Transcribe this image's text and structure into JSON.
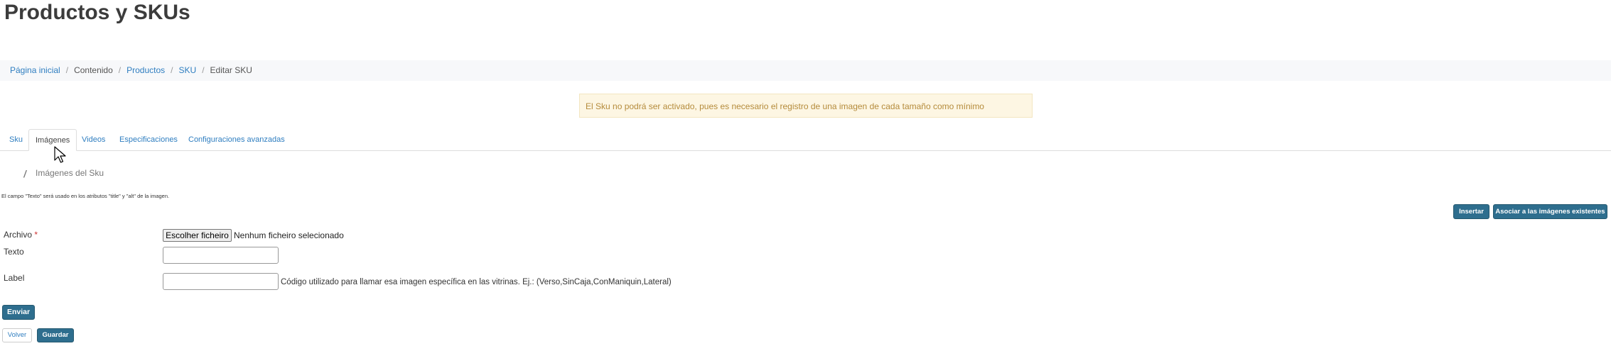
{
  "page": {
    "title": "Productos y SKUs"
  },
  "breadcrumb": [
    {
      "label": "Página inicial",
      "link": true
    },
    {
      "label": "Contenido",
      "link": false
    },
    {
      "label": "Productos",
      "link": true
    },
    {
      "label": "SKU",
      "link": true
    },
    {
      "label": "Editar SKU",
      "link": false
    }
  ],
  "alert": {
    "text": "El Sku no podrá ser activado, pues es necesario el registro de una imagen de cada tamaño como mínimo"
  },
  "tabs": [
    {
      "label": "Sku",
      "active": false
    },
    {
      "label": "Imágenes",
      "active": true
    },
    {
      "label": "Videos",
      "active": false
    },
    {
      "label": "Especificaciones",
      "active": false
    },
    {
      "label": "Configuraciones avanzadas",
      "active": false
    }
  ],
  "section": {
    "title": "Imágenes del Sku",
    "icon": "pencil-icon"
  },
  "note": "El campo \"Texto\" será usado en los atributos \"title\" y \"alt\" de la imagen.",
  "actions": {
    "insert": "Insertar",
    "associate": "Asociar a las imágenes existentes"
  },
  "form": {
    "archivo_label": "Archivo",
    "required_mark": "*",
    "file_button": "Escolher ficheiro",
    "file_status": "Nenhum ficheiro selecionado",
    "texto_label": "Texto",
    "texto_value": "",
    "label_label": "Label",
    "label_value": "",
    "label_hint": "Código utilizado para llamar esa imagen específica en las vitrinas. Ej.: (Verso,SinCaja,ConManiquin,Lateral)",
    "submit": "Enviar"
  },
  "footer": {
    "back": "Volver",
    "save": "Guardar"
  },
  "colors": {
    "primary_button": "#2e6e8e",
    "link": "#2f7ec0",
    "alert_bg": "#fdf6e3",
    "alert_text": "#b58b3b"
  }
}
